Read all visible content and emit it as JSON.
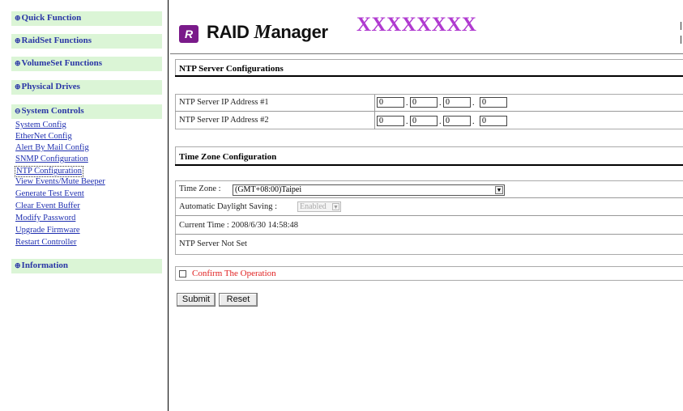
{
  "sidebar": {
    "sections": [
      {
        "label": "Quick Function"
      },
      {
        "label": "RaidSet Functions"
      },
      {
        "label": "VolumeSet Functions"
      },
      {
        "label": "Physical Drives"
      },
      {
        "label": "System Controls"
      },
      {
        "label": "Information"
      }
    ],
    "system_items": [
      "System Config",
      "EtherNet Config",
      "Alert By Mail Config",
      "SNMP Configuration",
      "NTP Configuration",
      "View Events/Mute Beeper",
      "Generate Test Event",
      "Clear Event Buffer",
      "Modify Password",
      "Upgrade Firmware",
      "Restart Controller"
    ],
    "active_item": "NTP Configuration"
  },
  "header": {
    "logo_badge": "R",
    "logo_text_1": "RAID",
    "logo_text_script": "M",
    "logo_text_2": "anager",
    "model_name": "XXXXXXXX"
  },
  "ntp": {
    "title": "NTP Server Configurations",
    "server1_label": "NTP Server IP Address #1",
    "server2_label": "NTP Server IP Address #2",
    "server1_octets": [
      "0",
      "0",
      "0",
      "0"
    ],
    "server2_octets": [
      "0",
      "0",
      "0",
      "0"
    ]
  },
  "timezone": {
    "title": "Time Zone Configuration",
    "zone_label": "Time Zone :",
    "zone_value": "(GMT+08:00)Taipei",
    "dst_label": "Automatic Daylight Saving :",
    "dst_value": "Enabled",
    "current_time": "Current Time : 2008/6/30 14:58:48",
    "ntp_status": "NTP Server Not Set"
  },
  "confirm": {
    "label": "Confirm The Operation",
    "checked": false
  },
  "buttons": {
    "submit": "Submit",
    "reset": "Reset"
  },
  "colors": {
    "sidebar_section_bg": "#dbf5d6",
    "link": "#1f2fb0",
    "model_name": "#b03ad0",
    "confirm_text": "#e02020"
  }
}
